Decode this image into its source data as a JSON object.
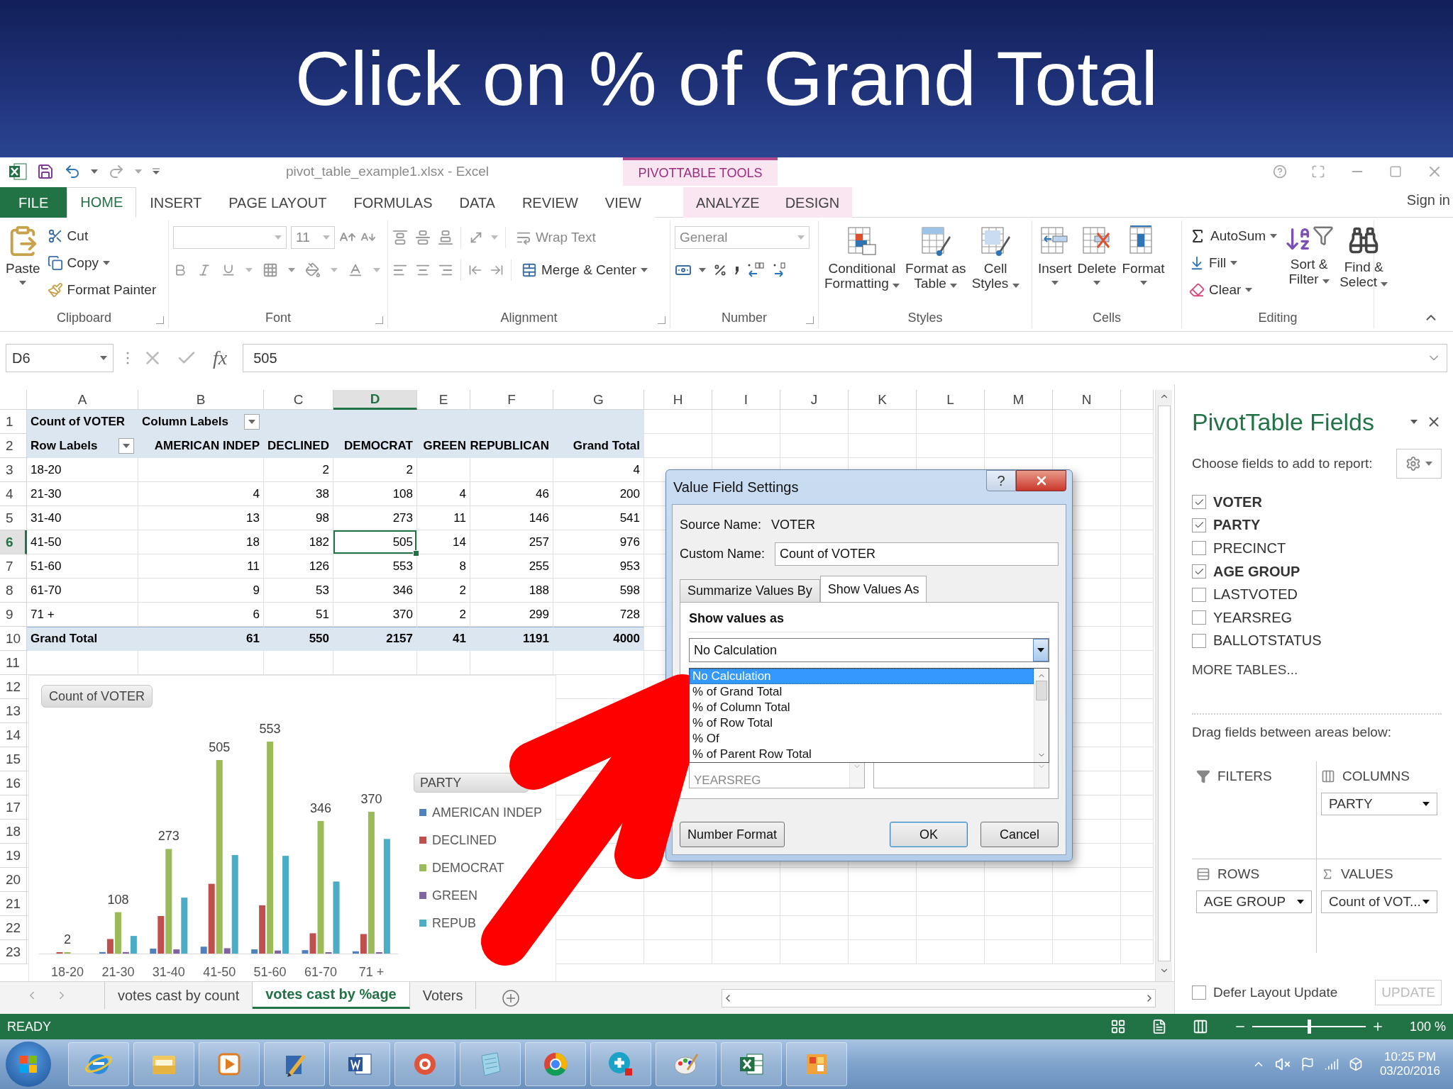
{
  "banner": {
    "title": "Click on % of Grand Total"
  },
  "title_bar": {
    "document": "pivot_table_example1.xlsx - Excel",
    "context_label": "PIVOTTABLE TOOLS"
  },
  "tabs": [
    {
      "label": "FILE",
      "kind": "file",
      "selected": false
    },
    {
      "label": "HOME",
      "kind": "main",
      "selected": true
    },
    {
      "label": "INSERT",
      "kind": "main",
      "selected": false
    },
    {
      "label": "PAGE LAYOUT",
      "kind": "main",
      "selected": false
    },
    {
      "label": "FORMULAS",
      "kind": "main",
      "selected": false
    },
    {
      "label": "DATA",
      "kind": "main",
      "selected": false
    },
    {
      "label": "REVIEW",
      "kind": "main",
      "selected": false
    },
    {
      "label": "VIEW",
      "kind": "main",
      "selected": false
    },
    {
      "label": "ANALYZE",
      "kind": "context",
      "selected": false
    },
    {
      "label": "DESIGN",
      "kind": "context",
      "selected": false
    }
  ],
  "account": {
    "label": "Sign in"
  },
  "ribbon": [
    {
      "kind": "clipboard",
      "label": "Clipboard",
      "items": [
        "Paste",
        "Cut",
        "Copy",
        "Format Painter"
      ]
    },
    {
      "kind": "font",
      "label": "Font",
      "font_size": "11"
    },
    {
      "kind": "alignment",
      "label": "Alignment",
      "items": [
        "Wrap Text",
        "Merge & Center"
      ]
    },
    {
      "kind": "number",
      "label": "Number",
      "format": "General"
    },
    {
      "kind": "styles",
      "label": "Styles",
      "items": [
        [
          "Conditional",
          "Formatting"
        ],
        [
          "Format as",
          "Table"
        ],
        [
          "Cell",
          "Styles"
        ]
      ]
    },
    {
      "kind": "cells",
      "label": "Cells",
      "items": [
        "Insert",
        "Delete",
        "Format"
      ]
    },
    {
      "kind": "editing",
      "label": "Editing",
      "small_items": [
        "AutoSum",
        "Fill",
        "Clear"
      ],
      "big_items": [
        [
          "Sort &",
          "Filter"
        ],
        [
          "Find &",
          "Select"
        ]
      ]
    }
  ],
  "formula_bar": {
    "name_box": "D6",
    "function_label": "fx",
    "formula": "505"
  },
  "sheet": {
    "columns": [
      {
        "label": "A",
        "selected": false
      },
      {
        "label": "B",
        "selected": false
      },
      {
        "label": "C",
        "selected": false
      },
      {
        "label": "D",
        "selected": true
      },
      {
        "label": "E",
        "selected": false
      },
      {
        "label": "F",
        "selected": false
      },
      {
        "label": "G",
        "selected": false
      },
      {
        "label": "H",
        "selected": false
      },
      {
        "label": "I",
        "selected": false
      },
      {
        "label": "J",
        "selected": false
      },
      {
        "label": "K",
        "selected": false
      },
      {
        "label": "L",
        "selected": false
      },
      {
        "label": "M",
        "selected": false
      },
      {
        "label": "N",
        "selected": false
      }
    ],
    "rows": [
      {
        "number": "1",
        "kind": "label",
        "selected": false,
        "cells": [
          "Count of VOTER",
          "Column Labels"
        ]
      },
      {
        "number": "2",
        "kind": "header",
        "selected": false,
        "cells": [
          "Row Labels",
          "AMERICAN INDEP",
          "DECLINED",
          "DEMOCRAT",
          "GREEN",
          "REPUBLICAN",
          "Grand Total"
        ]
      },
      {
        "number": "3",
        "kind": "data",
        "selected": false,
        "cells": [
          "18-20",
          null,
          "2",
          "2",
          null,
          null,
          "4"
        ]
      },
      {
        "number": "4",
        "kind": "data",
        "selected": false,
        "cells": [
          "21-30",
          "4",
          "38",
          "108",
          "4",
          "46",
          "200"
        ]
      },
      {
        "number": "5",
        "kind": "data",
        "selected": false,
        "cells": [
          "31-40",
          "13",
          "98",
          "273",
          "11",
          "146",
          "541"
        ]
      },
      {
        "number": "6",
        "kind": "data",
        "selected": true,
        "cells": [
          "41-50",
          "18",
          "182",
          "505",
          "14",
          "257",
          "976"
        ]
      },
      {
        "number": "7",
        "kind": "data",
        "selected": false,
        "cells": [
          "51-60",
          "11",
          "126",
          "553",
          "8",
          "255",
          "953"
        ]
      },
      {
        "number": "8",
        "kind": "data",
        "selected": false,
        "cells": [
          "61-70",
          "9",
          "53",
          "346",
          "2",
          "188",
          "598"
        ]
      },
      {
        "number": "9",
        "kind": "data",
        "selected": false,
        "cells": [
          "71 +",
          "6",
          "51",
          "370",
          "2",
          "299",
          "728"
        ]
      },
      {
        "number": "10",
        "kind": "total",
        "selected": false,
        "cells": [
          "Grand Total",
          "61",
          "550",
          "2157",
          "41",
          "1191",
          "4000"
        ]
      },
      {
        "number": "11",
        "kind": "blank",
        "selected": false
      },
      {
        "number": "12",
        "kind": "blank",
        "selected": false
      },
      {
        "number": "13",
        "kind": "blank",
        "selected": false
      },
      {
        "number": "14",
        "kind": "blank",
        "selected": false
      },
      {
        "number": "15",
        "kind": "blank",
        "selected": false
      },
      {
        "number": "16",
        "kind": "blank",
        "selected": false
      },
      {
        "number": "17",
        "kind": "blank",
        "selected": false
      },
      {
        "number": "18",
        "kind": "blank",
        "selected": false
      },
      {
        "number": "19",
        "kind": "blank",
        "selected": false
      },
      {
        "number": "20",
        "kind": "blank",
        "selected": false
      },
      {
        "number": "21",
        "kind": "blank",
        "selected": false
      },
      {
        "number": "22",
        "kind": "blank",
        "selected": false
      },
      {
        "number": "23",
        "kind": "blank",
        "selected": false
      }
    ]
  },
  "chart": {
    "field_button": "Count of VOTER",
    "legend_title": "PARTY",
    "chart_data": {
      "type": "bar",
      "legend": "right",
      "categories": [
        "18-20",
        "21-30",
        "31-40",
        "41-50",
        "51-60",
        "61-70",
        "71 +"
      ],
      "series": [
        {
          "name": "AMERICAN INDEP",
          "color": "#4f81bd",
          "values": [
            null,
            4,
            13,
            18,
            11,
            9,
            6
          ]
        },
        {
          "name": "DECLINED",
          "color": "#c0504d",
          "values": [
            2,
            38,
            98,
            182,
            126,
            53,
            51
          ]
        },
        {
          "name": "DEMOCRAT",
          "color": "#9bbb59",
          "values": [
            2,
            108,
            273,
            505,
            553,
            346,
            370
          ],
          "data_labels": true
        },
        {
          "name": "GREEN",
          "color": "#8064a2",
          "values": [
            null,
            4,
            11,
            14,
            8,
            2,
            2
          ]
        },
        {
          "name": "REPUB",
          "color": "#4bacc6",
          "values": [
            null,
            46,
            146,
            257,
            255,
            188,
            299
          ]
        }
      ]
    }
  },
  "dialog": {
    "title": "Value Field Settings",
    "help_label": "?",
    "source_label": "Source Name:",
    "source_value": "VOTER",
    "custom_label": "Custom Name:",
    "custom_value": "Count of VOTER",
    "tabs": [
      {
        "label": "Summarize Values By",
        "selected": false
      },
      {
        "label": "Show Values As",
        "selected": true
      }
    ],
    "section_label": "Show values as",
    "select_value": "No Calculation",
    "options": [
      {
        "label": "No Calculation",
        "selected": true
      },
      {
        "label": "% of Grand Total",
        "selected": false
      },
      {
        "label": "% of Column Total",
        "selected": false
      },
      {
        "label": "% of Row Total",
        "selected": false
      },
      {
        "label": "% Of",
        "selected": false
      },
      {
        "label": "% of Parent Row Total",
        "selected": false
      }
    ],
    "base_fields": [
      "YEARSREG"
    ],
    "buttons": [
      {
        "label": "Number Format",
        "kind": "secondary"
      },
      {
        "label": "OK",
        "kind": "default"
      },
      {
        "label": "Cancel",
        "kind": "secondary"
      }
    ]
  },
  "pivot_pane": {
    "title": "PivotTable Fields",
    "subtitle": "Choose fields to add to report:",
    "fields": [
      {
        "label": "VOTER",
        "checked": true
      },
      {
        "label": "PARTY",
        "checked": true
      },
      {
        "label": "PRECINCT",
        "checked": false
      },
      {
        "label": "AGE GROUP",
        "checked": true
      },
      {
        "label": "LASTVOTED",
        "checked": false
      },
      {
        "label": "YEARSREG",
        "checked": false
      },
      {
        "label": "BALLOTSTATUS",
        "checked": false
      }
    ],
    "more_tables": "MORE TABLES...",
    "drag_hint": "Drag fields between areas below:",
    "areas": [
      {
        "label": "FILTERS",
        "kind": "filters"
      },
      {
        "label": "COLUMNS",
        "kind": "columns",
        "field": "PARTY"
      },
      {
        "label": "ROWS",
        "kind": "rows",
        "field": "AGE GROUP"
      },
      {
        "label": "VALUES",
        "kind": "values",
        "field": "Count of VOT..."
      }
    ],
    "defer": {
      "label": "Defer Layout Update",
      "checked": false
    },
    "update": {
      "label": "UPDATE",
      "disabled": true
    }
  },
  "sheet_tabs": [
    {
      "label": "votes cast by count",
      "selected": false
    },
    {
      "label": "votes cast by %age",
      "selected": true
    },
    {
      "label": "Voters",
      "selected": false
    }
  ],
  "status_bar": {
    "status": "READY",
    "zoom": "100 %",
    "zoom_slider": {
      "level": 0.5
    }
  },
  "taskbar": {
    "time": "10:25 PM",
    "date": "03/20/2016"
  }
}
